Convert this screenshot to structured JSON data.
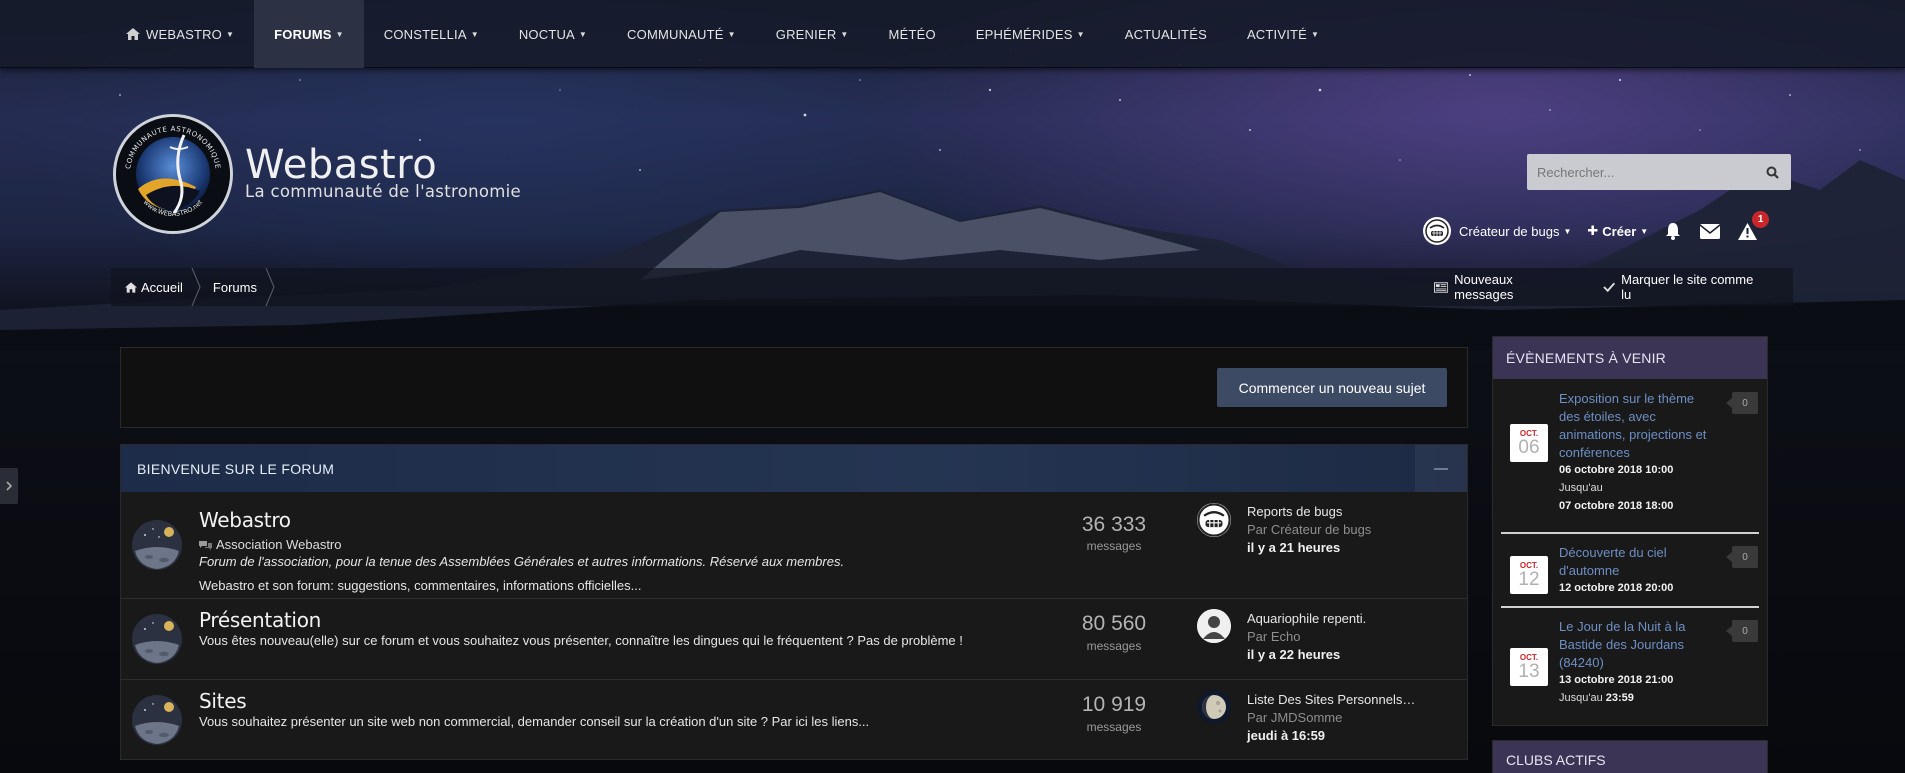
{
  "nav": {
    "items": [
      {
        "label": "WEBASTRO",
        "icon": "home-icon",
        "caret": true,
        "active": false
      },
      {
        "label": "FORUMS",
        "caret": true,
        "active": true
      },
      {
        "label": "CONSTELLIA",
        "caret": true,
        "active": false
      },
      {
        "label": "NOCTUA",
        "caret": true,
        "active": false
      },
      {
        "label": "COMMUNAUTÉ",
        "caret": true,
        "active": false
      },
      {
        "label": "GRENIER",
        "caret": true,
        "active": false
      },
      {
        "label": "MÉTÉO",
        "caret": false,
        "active": false
      },
      {
        "label": "EPHÉMÉRIDES",
        "caret": true,
        "active": false
      },
      {
        "label": "ACTUALITÉS",
        "caret": false,
        "active": false
      },
      {
        "label": "ACTIVITÉ",
        "caret": true,
        "active": false
      }
    ]
  },
  "brand": {
    "title": "Webastro",
    "subtitle": "La communauté de l'astronomie",
    "logo_ring_top": "COMMUNAUTE ASTRONOMIQUE",
    "logo_ring_bottom": "www.WEBASTRO.net"
  },
  "search": {
    "placeholder": "Rechercher..."
  },
  "user": {
    "name": "Créateur de bugs",
    "create_label": "Créer",
    "alerts_count": "1"
  },
  "breadcrumb": {
    "items": [
      {
        "label": "Accueil"
      },
      {
        "label": "Forums"
      }
    ],
    "new_messages": "Nouveaux messages",
    "mark_read": "Marquer le site comme lu"
  },
  "actions": {
    "new_topic": "Commencer un nouveau sujet"
  },
  "category": {
    "title": "BIENVENUE SUR LE FORUM",
    "forums": [
      {
        "name": "Webastro",
        "sub": "Association Webastro",
        "desc_italic": "Forum de l'association, pour la tenue des Assemblées Générales et autres informations. Réservé aux membres.",
        "desc": "Webastro et son forum: suggestions, commentaires, informations officielles...",
        "count": "36 333",
        "count_label": "messages",
        "last_title": "Reports de bugs",
        "last_by": "Par Créateur de bugs",
        "last_time": "il y a 21 heures"
      },
      {
        "name": "Présentation",
        "desc": "Vous êtes nouveau(elle) sur ce forum et vous souhaitez vous présenter, connaître les dingues qui le fréquentent ? Pas de problème !",
        "count": "80 560",
        "count_label": "messages",
        "last_title": "Aquariophile repenti.",
        "last_by": "Par Echo",
        "last_time": "il y a 22 heures"
      },
      {
        "name": "Sites",
        "desc": "Vous souhaitez présenter un site web non commercial, demander conseil sur la création d'un site ? Par ici les liens...",
        "count": "10 919",
        "count_label": "messages",
        "last_title": "Liste Des Sites Personnels…",
        "last_by": "Par JMDSomme",
        "last_time": "jeudi à 16:59"
      }
    ]
  },
  "events": {
    "title": "ÉVÈNEMENTS À VENIR",
    "items": [
      {
        "month": "OCT.",
        "day": "06",
        "title": "Exposition sur le thème des étoiles, avec animations, projections et conférences",
        "line1": "06 octobre 2018 10:00",
        "line2": "Jusqu'au",
        "line3": "07 octobre 2018 18:00",
        "count": "0"
      },
      {
        "month": "OCT.",
        "day": "12",
        "title": "Découverte du ciel d'automne",
        "line1": "12 octobre 2018 20:00",
        "count": "0"
      },
      {
        "month": "OCT.",
        "day": "13",
        "title": "Le Jour de la Nuit à la Bastide des Jourdans (84240)",
        "line1": "13 octobre 2018 21:00",
        "line2_prefix": "Jusqu'au",
        "line2_time": "23:59",
        "count": "0"
      }
    ]
  },
  "clubs": {
    "title": "CLUBS ACTIFS"
  },
  "colors": {
    "nav_bg": "#1a1e30",
    "nav_active": "#2c3144",
    "category_header": "#243552",
    "sidebar_header": "#3c3454",
    "button": "#3c4a63",
    "link": "#6d8fc4",
    "badge": "#c8262b"
  }
}
